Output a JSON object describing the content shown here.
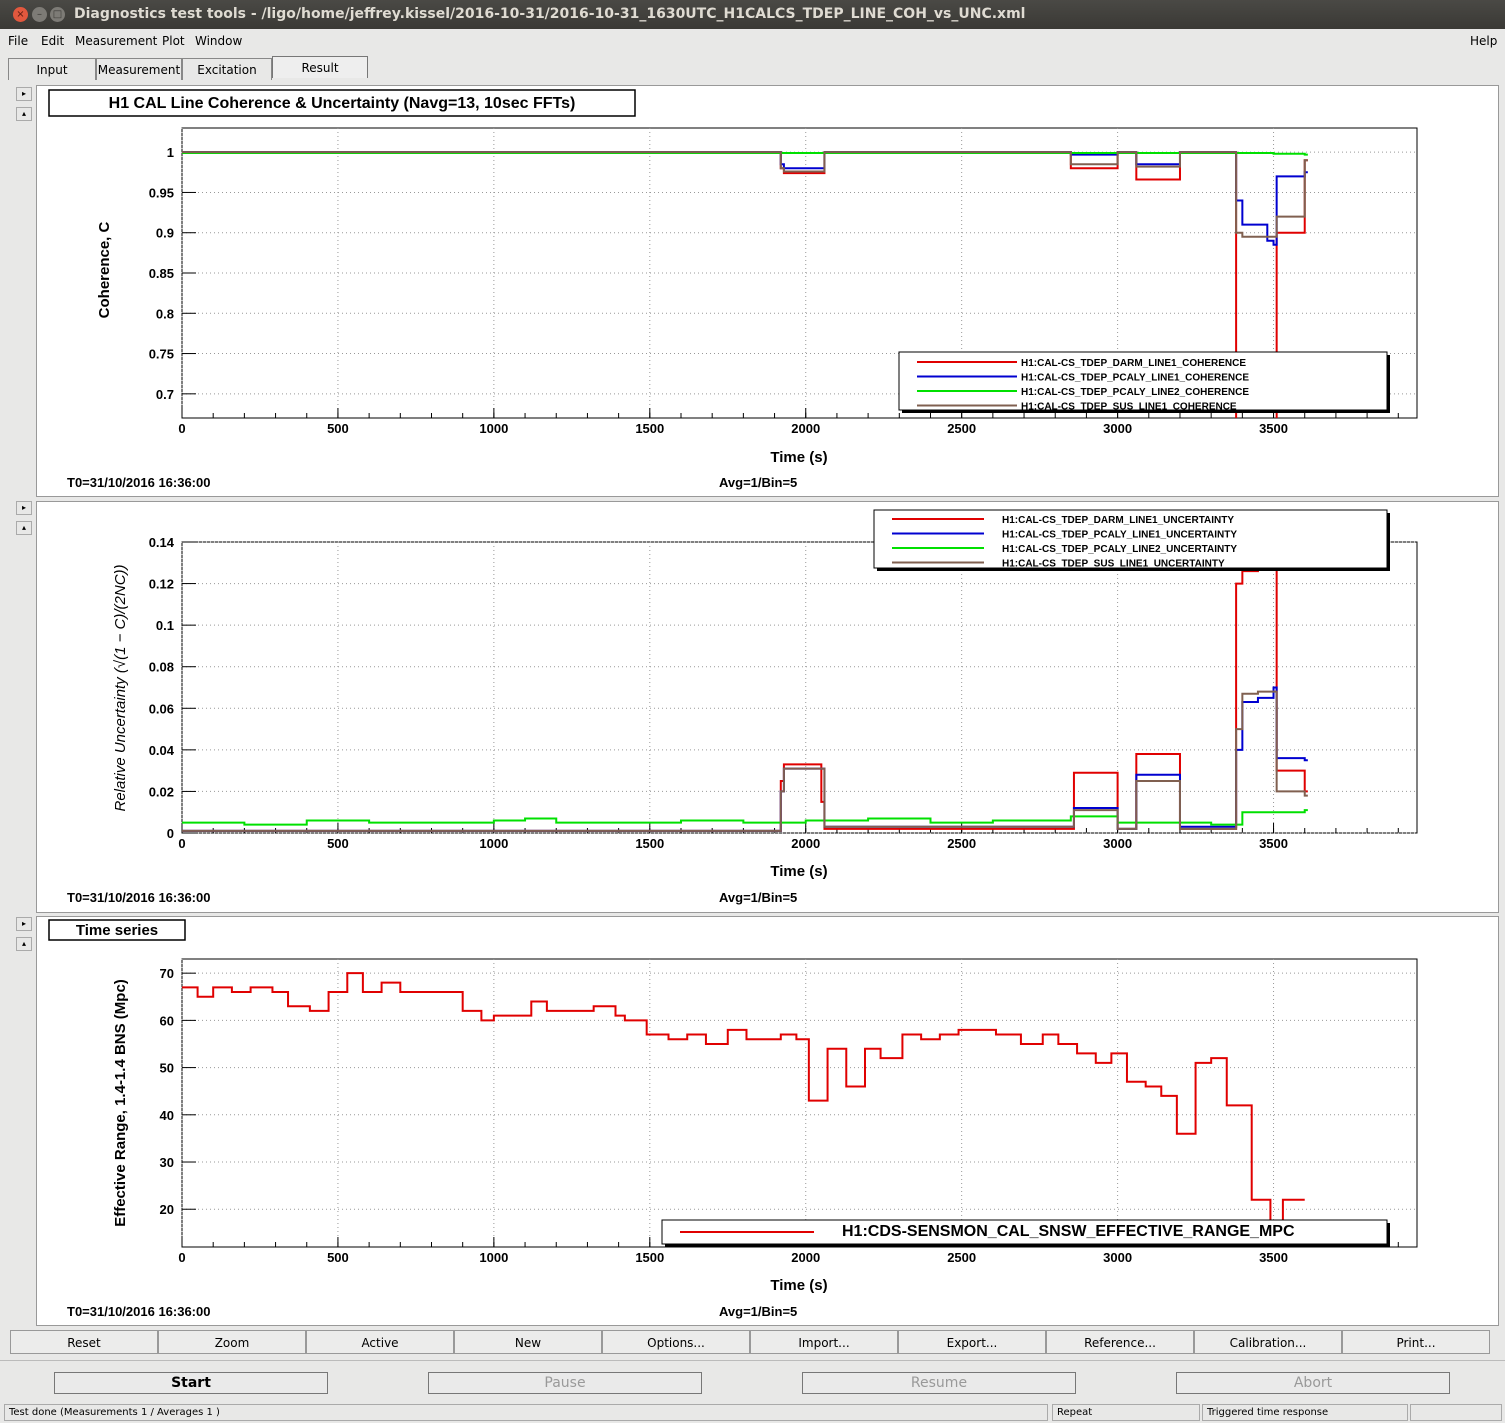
{
  "window": {
    "title": "Diagnostics test tools - /ligo/home/jeffrey.kissel/2016-10-31/2016-10-31_1630UTC_H1CALCS_TDEP_LINE_COH_vs_UNC.xml",
    "close_glyph": "×",
    "minimize_glyph": "–",
    "maximize_glyph": "□"
  },
  "menu": {
    "items": [
      "File",
      "Edit",
      "Measurement",
      "Plot",
      "Window"
    ],
    "help": "Help"
  },
  "tabs": [
    "Input",
    "Measurement",
    "Excitation",
    "Result"
  ],
  "active_tab": "Result",
  "pads": {
    "coherence": {
      "title": "H1 CAL Line Coherence & Uncertainty (Navg=13, 10sec FFTs)",
      "ylabel": "Coherence, C",
      "xlabel": "Time (s)",
      "t0": "T0=31/10/2016 16:36:00",
      "avg": "Avg=1/Bin=5",
      "yticks": [
        "1",
        "0.95",
        "0.9",
        "0.85",
        "0.8",
        "0.75",
        "0.7"
      ],
      "xticks": [
        "0",
        "500",
        "1000",
        "1500",
        "2000",
        "2500",
        "3000",
        "3500"
      ],
      "legend": [
        "H1:CAL-CS_TDEP_DARM_LINE1_COHERENCE",
        "H1:CAL-CS_TDEP_PCALY_LINE1_COHERENCE",
        "H1:CAL-CS_TDEP_PCALY_LINE2_COHERENCE",
        "H1:CAL-CS_TDEP_SUS_LINE1_COHERENCE"
      ]
    },
    "uncertainty": {
      "ylabel": "Relative Uncertainty (√(1 − C)/(2NC))",
      "xlabel": "Time (s)",
      "t0": "T0=31/10/2016 16:36:00",
      "avg": "Avg=1/Bin=5",
      "yticks": [
        "0.14",
        "0.12",
        "0.1",
        "0.08",
        "0.06",
        "0.04",
        "0.02",
        "0"
      ],
      "xticks": [
        "0",
        "500",
        "1000",
        "1500",
        "2000",
        "2500",
        "3000",
        "3500"
      ],
      "legend": [
        "H1:CAL-CS_TDEP_DARM_LINE1_UNCERTAINTY",
        "H1:CAL-CS_TDEP_PCALY_LINE1_UNCERTAINTY",
        "H1:CAL-CS_TDEP_PCALY_LINE2_UNCERTAINTY",
        "H1:CAL-CS_TDEP_SUS_LINE1_UNCERTAINTY"
      ]
    },
    "range": {
      "title": "Time series",
      "ylabel": "Effective Range, 1.4-1.4 BNS (Mpc)",
      "xlabel": "Time (s)",
      "t0": "T0=31/10/2016 16:36:00",
      "avg": "Avg=1/Bin=5",
      "yticks": [
        "70",
        "60",
        "50",
        "40",
        "30",
        "20"
      ],
      "xticks": [
        "0",
        "500",
        "1000",
        "1500",
        "2000",
        "2500",
        "3000",
        "3500"
      ],
      "legend": [
        "H1:CDS-SENSMON_CAL_SNSW_EFFECTIVE_RANGE_MPC"
      ]
    }
  },
  "colors": {
    "red": "#e00000",
    "blue": "#0000d0",
    "green": "#00e000",
    "brown": "#806050"
  },
  "chart_data": [
    {
      "type": "line",
      "title": "H1 CAL Line Coherence & Uncertainty (Navg=13, 10sec FFTs)",
      "xlabel": "Time (s)",
      "ylabel": "Coherence, C",
      "xlim": [
        0,
        3960
      ],
      "ylim": [
        0.67,
        1.03
      ],
      "grid": true,
      "legend": "bottom-right",
      "series": [
        {
          "name": "H1:CAL-CS_TDEP_DARM_LINE1_COHERENCE",
          "color": "#e00000",
          "x": [
            0,
            1910,
            1920,
            1930,
            2050,
            2060,
            2850,
            2980,
            3000,
            3050,
            3060,
            3190,
            3200,
            3370,
            3380,
            3500,
            3510,
            3600
          ],
          "y": [
            1,
            1,
            0.98,
            0.974,
            0.974,
            1,
            0.98,
            0.98,
            1,
            1,
            0.966,
            0.966,
            1,
            1,
            0.5,
            0.5,
            0.9,
            0.99
          ]
        },
        {
          "name": "H1:CAL-CS_TDEP_PCALY_LINE1_COHERENCE",
          "color": "#0000d0",
          "x": [
            0,
            1910,
            1920,
            1930,
            2050,
            2060,
            2850,
            2980,
            3000,
            3050,
            3060,
            3190,
            3200,
            3370,
            3380,
            3400,
            3450,
            3480,
            3500,
            3510,
            3600
          ],
          "y": [
            1,
            1,
            0.985,
            0.98,
            0.98,
            1,
            0.997,
            0.997,
            1,
            1,
            0.985,
            0.985,
            1,
            1,
            0.94,
            0.91,
            0.91,
            0.89,
            0.885,
            0.97,
            0.975
          ]
        },
        {
          "name": "H1:CAL-CS_TDEP_PCALY_LINE2_COHERENCE",
          "color": "#00e000",
          "x": [
            0,
            500,
            1000,
            1500,
            2000,
            2500,
            3000,
            3500,
            3600
          ],
          "y": [
            0.999,
            0.999,
            0.999,
            0.999,
            0.999,
            0.999,
            0.999,
            0.998,
            0.997
          ]
        },
        {
          "name": "H1:CAL-CS_TDEP_SUS_LINE1_COHERENCE",
          "color": "#806050",
          "x": [
            0,
            1910,
            1920,
            1930,
            2050,
            2060,
            2850,
            2980,
            3000,
            3050,
            3060,
            3190,
            3200,
            3370,
            3380,
            3400,
            3460,
            3500,
            3510,
            3600
          ],
          "y": [
            1,
            1,
            0.98,
            0.976,
            0.976,
            1,
            0.985,
            0.985,
            1,
            1,
            0.982,
            0.982,
            1,
            1,
            0.9,
            0.895,
            0.895,
            0.895,
            0.92,
            0.99
          ]
        }
      ]
    },
    {
      "type": "line",
      "xlabel": "Time (s)",
      "ylabel": "Relative Uncertainty (√(1 − C)/(2NC))",
      "xlim": [
        0,
        3960
      ],
      "ylim": [
        0,
        0.14
      ],
      "grid": true,
      "legend": "top-right",
      "series": [
        {
          "name": "H1:CAL-CS_TDEP_DARM_LINE1_UNCERTAINTY",
          "color": "#e00000",
          "x": [
            0,
            1910,
            1920,
            1930,
            2040,
            2050,
            2060,
            2850,
            2860,
            2980,
            3000,
            3050,
            3060,
            3190,
            3200,
            3370,
            3380,
            3400,
            3450,
            3500,
            3510,
            3600
          ],
          "y": [
            0.001,
            0.001,
            0.025,
            0.033,
            0.033,
            0.015,
            0.002,
            0.002,
            0.029,
            0.029,
            0.002,
            0.002,
            0.038,
            0.038,
            0.002,
            0.002,
            0.12,
            0.126,
            0.13,
            0.13,
            0.03,
            0.02
          ]
        },
        {
          "name": "H1:CAL-CS_TDEP_PCALY_LINE1_UNCERTAINTY",
          "color": "#0000d0",
          "x": [
            0,
            1910,
            1920,
            1930,
            2040,
            2060,
            2850,
            2860,
            2980,
            3000,
            3050,
            3060,
            3190,
            3200,
            3370,
            3380,
            3400,
            3450,
            3500,
            3510,
            3600
          ],
          "y": [
            0.001,
            0.001,
            0.02,
            0.031,
            0.031,
            0.003,
            0.003,
            0.012,
            0.012,
            0.002,
            0.002,
            0.028,
            0.028,
            0.003,
            0.003,
            0.04,
            0.063,
            0.065,
            0.07,
            0.036,
            0.035
          ]
        },
        {
          "name": "H1:CAL-CS_TDEP_PCALY_LINE2_UNCERTAINTY",
          "color": "#00e000",
          "x": [
            0,
            200,
            400,
            600,
            800,
            1000,
            1100,
            1200,
            1400,
            1600,
            1800,
            2000,
            2200,
            2400,
            2600,
            2800,
            2850,
            3000,
            3200,
            3300,
            3400,
            3500,
            3600
          ],
          "y": [
            0.005,
            0.004,
            0.006,
            0.005,
            0.005,
            0.006,
            0.007,
            0.005,
            0.005,
            0.006,
            0.005,
            0.006,
            0.007,
            0.005,
            0.006,
            0.006,
            0.008,
            0.005,
            0.005,
            0.004,
            0.01,
            0.01,
            0.011
          ]
        },
        {
          "name": "H1:CAL-CS_TDEP_SUS_LINE1_UNCERTAINTY",
          "color": "#806050",
          "x": [
            0,
            1910,
            1920,
            1930,
            2040,
            2060,
            2850,
            2860,
            2980,
            3000,
            3050,
            3060,
            3190,
            3200,
            3370,
            3380,
            3400,
            3450,
            3500,
            3510,
            3600
          ],
          "y": [
            0.001,
            0.001,
            0.02,
            0.031,
            0.031,
            0.003,
            0.003,
            0.011,
            0.011,
            0.002,
            0.002,
            0.025,
            0.025,
            0.002,
            0.002,
            0.05,
            0.067,
            0.068,
            0.068,
            0.02,
            0.018
          ]
        }
      ]
    },
    {
      "type": "line",
      "title": "Time series",
      "xlabel": "Time (s)",
      "ylabel": "Effective Range, 1.4-1.4 BNS (Mpc)",
      "xlim": [
        0,
        3960
      ],
      "ylim": [
        12,
        73
      ],
      "grid": true,
      "legend": "bottom-right",
      "series": [
        {
          "name": "H1:CDS-SENSMON_CAL_SNSW_EFFECTIVE_RANGE_MPC",
          "color": "#e00000",
          "x": [
            0,
            50,
            100,
            160,
            220,
            290,
            340,
            410,
            470,
            530,
            580,
            640,
            700,
            760,
            880,
            900,
            960,
            1000,
            1070,
            1120,
            1170,
            1260,
            1320,
            1390,
            1420,
            1490,
            1560,
            1620,
            1680,
            1750,
            1810,
            1870,
            1920,
            1970,
            2010,
            2070,
            2130,
            2190,
            2240,
            2310,
            2370,
            2430,
            2490,
            2550,
            2610,
            2690,
            2760,
            2810,
            2870,
            2930,
            2980,
            3030,
            3090,
            3140,
            3190,
            3250,
            3300,
            3350,
            3390,
            3430,
            3490,
            3530,
            3550,
            3590
          ],
          "y": [
            67,
            65,
            67,
            66,
            67,
            66,
            63,
            62,
            66,
            70,
            66,
            68,
            66,
            66,
            66,
            62,
            60,
            61,
            61,
            64,
            62,
            62,
            63,
            61,
            60,
            57,
            56,
            57,
            55,
            58,
            56,
            56,
            57,
            56,
            43,
            54,
            46,
            54,
            52,
            57,
            56,
            57,
            58,
            58,
            57,
            55,
            57,
            55,
            53,
            51,
            53,
            47,
            46,
            44,
            36,
            51,
            52,
            42,
            42,
            22,
            16,
            22,
            22,
            22
          ]
        }
      ]
    }
  ],
  "bottom_buttons": [
    "Reset",
    "Zoom",
    "Active",
    "New",
    "Options...",
    "Import...",
    "Export...",
    "Reference...",
    "Calibration...",
    "Print..."
  ],
  "control_buttons": [
    "Start",
    "Pause",
    "Resume",
    "Abort"
  ],
  "status": {
    "left": "Test done (Measurements 1 / Averages 1 )",
    "mid": "Repeat",
    "right": "Triggered time response"
  },
  "arrow_glyphs": {
    "right": "▸",
    "up": "▴"
  }
}
